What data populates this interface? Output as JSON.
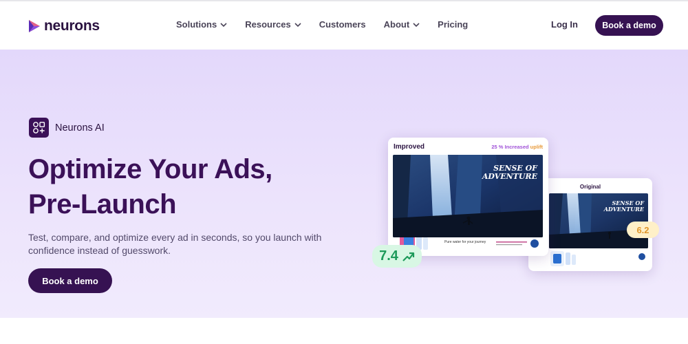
{
  "brand": {
    "name": "neurons"
  },
  "nav": {
    "items": [
      {
        "label": "Solutions",
        "has_dropdown": true
      },
      {
        "label": "Resources",
        "has_dropdown": true
      },
      {
        "label": "Customers",
        "has_dropdown": false
      },
      {
        "label": "About",
        "has_dropdown": true
      },
      {
        "label": "Pricing",
        "has_dropdown": false
      }
    ],
    "login_label": "Log In",
    "demo_label": "Book a demo"
  },
  "hero": {
    "badge_label": "Neurons AI",
    "headline_line1": "Optimize Your Ads,",
    "headline_line2": "Pre-Launch",
    "subtext": "Test, compare, and optimize every ad in seconds, so you launch with confidence instead of guesswork.",
    "cta_label": "Book a demo"
  },
  "cards": {
    "improved": {
      "label": "Improved",
      "uplift_prefix": "25 % Increased",
      "uplift_suffix": "uplift",
      "ad_headline_line1": "SENSE OF",
      "ad_headline_line2": "ADVENTURE",
      "ad_tagline": "Pure water for your journey",
      "score": "7.4"
    },
    "original": {
      "label": "Original",
      "ad_headline_line1": "SENSE OF",
      "ad_headline_line2": "ADVENTURE",
      "score": "6.2"
    }
  },
  "colors": {
    "brand_dark": "#361252",
    "headline": "#3b1158",
    "hero_bg": "#e3d8fb",
    "score_good": "#1d9a5a",
    "score_warn": "#e0962a"
  },
  "icons": {
    "logo": "neurons-logo-icon",
    "badge": "ai-shapes-icon",
    "chevron": "chevron-down-icon",
    "trend": "trend-up-icon"
  }
}
